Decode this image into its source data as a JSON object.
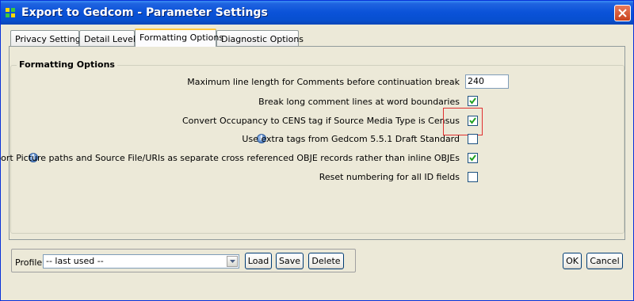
{
  "window": {
    "title": "Export to Gedcom - Parameter Settings"
  },
  "tabs": [
    {
      "label": "Privacy Settings"
    },
    {
      "label": "Detail Level"
    },
    {
      "label": "Formatting Options"
    },
    {
      "label": "Diagnostic Options"
    }
  ],
  "active_tab": "Formatting Options",
  "group": {
    "title": "Formatting Options",
    "options": [
      {
        "label": "Maximum line length for Comments before continuation break",
        "value": "240",
        "type": "text"
      },
      {
        "label": "Break long comment lines at word boundaries",
        "checked": true,
        "type": "checkbox"
      },
      {
        "label": "Convert Occupancy to CENS tag if Source Media Type is Census",
        "checked": true,
        "type": "checkbox"
      },
      {
        "label": "Use extra tags from Gedcom 5.5.1 Draft Standard",
        "checked": false,
        "type": "checkbox",
        "info": "info-icon"
      },
      {
        "label": "export Picture paths and Source File/URls as separate cross referenced OBJE records rather than inline OBJEs",
        "checked": true,
        "type": "checkbox",
        "info": "info-icon"
      },
      {
        "label": "Reset numbering for all ID fields",
        "checked": false,
        "type": "checkbox"
      }
    ]
  },
  "profile": {
    "label": "Profile",
    "selected": "-- last used --",
    "load_label": "Load",
    "save_label": "Save",
    "delete_label": "Delete"
  },
  "footer": {
    "ok_label": "OK",
    "cancel_label": "Cancel"
  },
  "colors": {
    "title_bar": "#0a52d8",
    "highlight": "#e03030",
    "tab_accent": "#ffc83c"
  }
}
